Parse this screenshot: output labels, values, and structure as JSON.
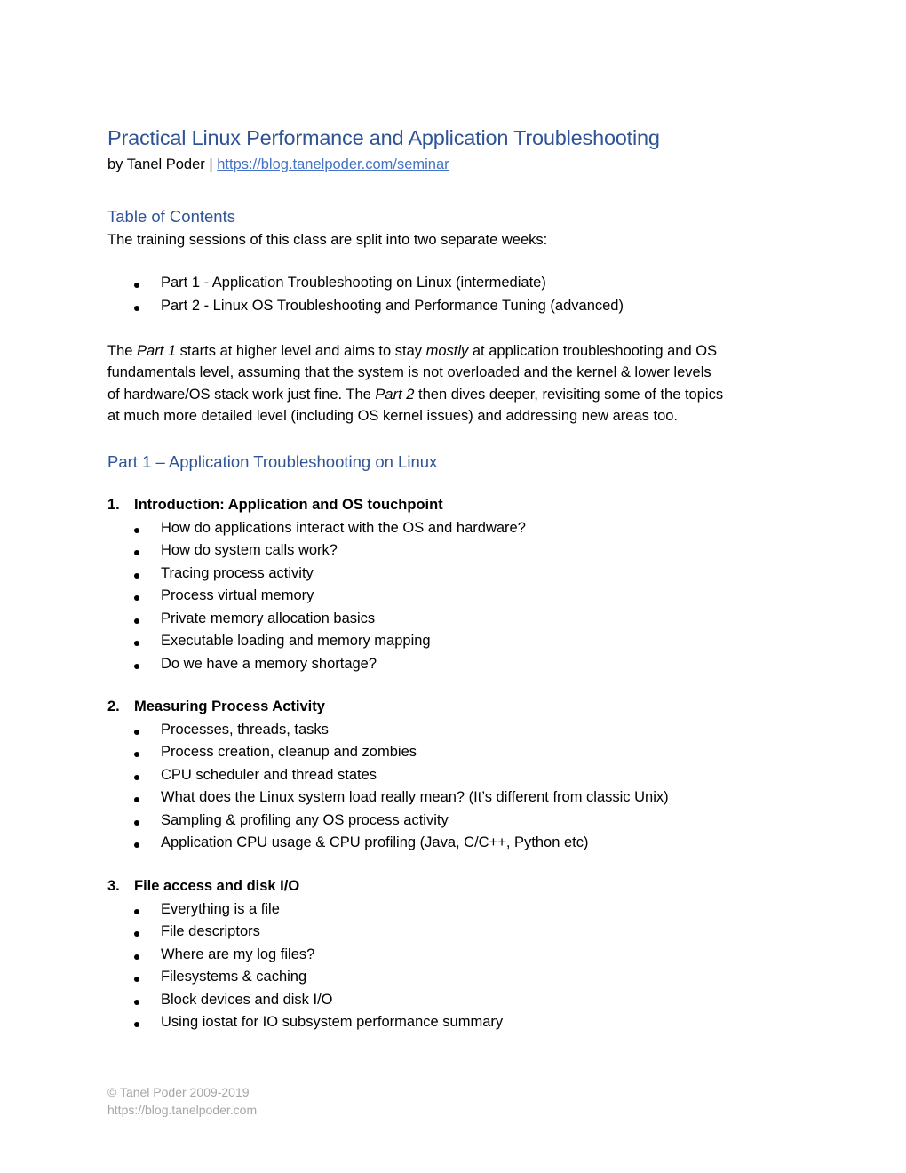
{
  "header": {
    "title": "Practical Linux Performance and Application Troubleshooting",
    "byline_prefix": "by Tanel Poder | ",
    "byline_link": "https://blog.tanelpoder.com/seminar"
  },
  "toc": {
    "heading": "Table of Contents",
    "intro": "The training sessions of this class are split into two separate weeks:",
    "parts": [
      "Part 1 - Application Troubleshooting on Linux (intermediate)",
      "Part 2 - Linux OS Troubleshooting and Performance Tuning (advanced)"
    ]
  },
  "overview": {
    "line1_a": "The ",
    "line1_b": "Part 1",
    "line1_c": " starts at higher level and aims to stay ",
    "line1_d": "mostly",
    "line1_e": " at application troubleshooting and OS",
    "line2": "fundamentals level, assuming that the system is not overloaded and the kernel & lower levels",
    "line3_a": "of hardware/OS stack work just fine. The ",
    "line3_b": "Part 2",
    "line3_c": " then dives deeper, revisiting some of the topics",
    "line4": "at much more detailed level (including OS kernel issues) and addressing new areas too."
  },
  "part1": {
    "heading": "Part 1 – Application Troubleshooting on Linux",
    "sections": [
      {
        "number": "1.",
        "title": "Introduction: Application and OS touchpoint",
        "items": [
          "How do applications interact with the OS and hardware?",
          "How do system calls work?",
          "Tracing process activity",
          "Process virtual memory",
          "Private memory allocation basics",
          "Executable loading and memory mapping",
          "Do we have a memory shortage?"
        ]
      },
      {
        "number": "2.",
        "title": "Measuring Process Activity",
        "items": [
          "Processes, threads, tasks",
          "Process creation, cleanup and zombies",
          "CPU scheduler and thread states",
          "What does the Linux system load really mean? (It’s different from classic Unix)",
          "Sampling & profiling any OS process activity",
          "Application CPU usage & CPU profiling (Java, C/C++, Python etc)"
        ]
      },
      {
        "number": "3.",
        "title": "File access and disk I/O",
        "items": [
          "Everything is a file",
          "File descriptors",
          "Where are my log files?",
          "Filesystems & caching",
          "Block devices and disk I/O",
          "Using iostat for IO subsystem performance summary"
        ]
      }
    ]
  },
  "footer": {
    "copyright": "© Tanel Poder 2009-2019",
    "url": "https://blog.tanelpoder.com"
  }
}
